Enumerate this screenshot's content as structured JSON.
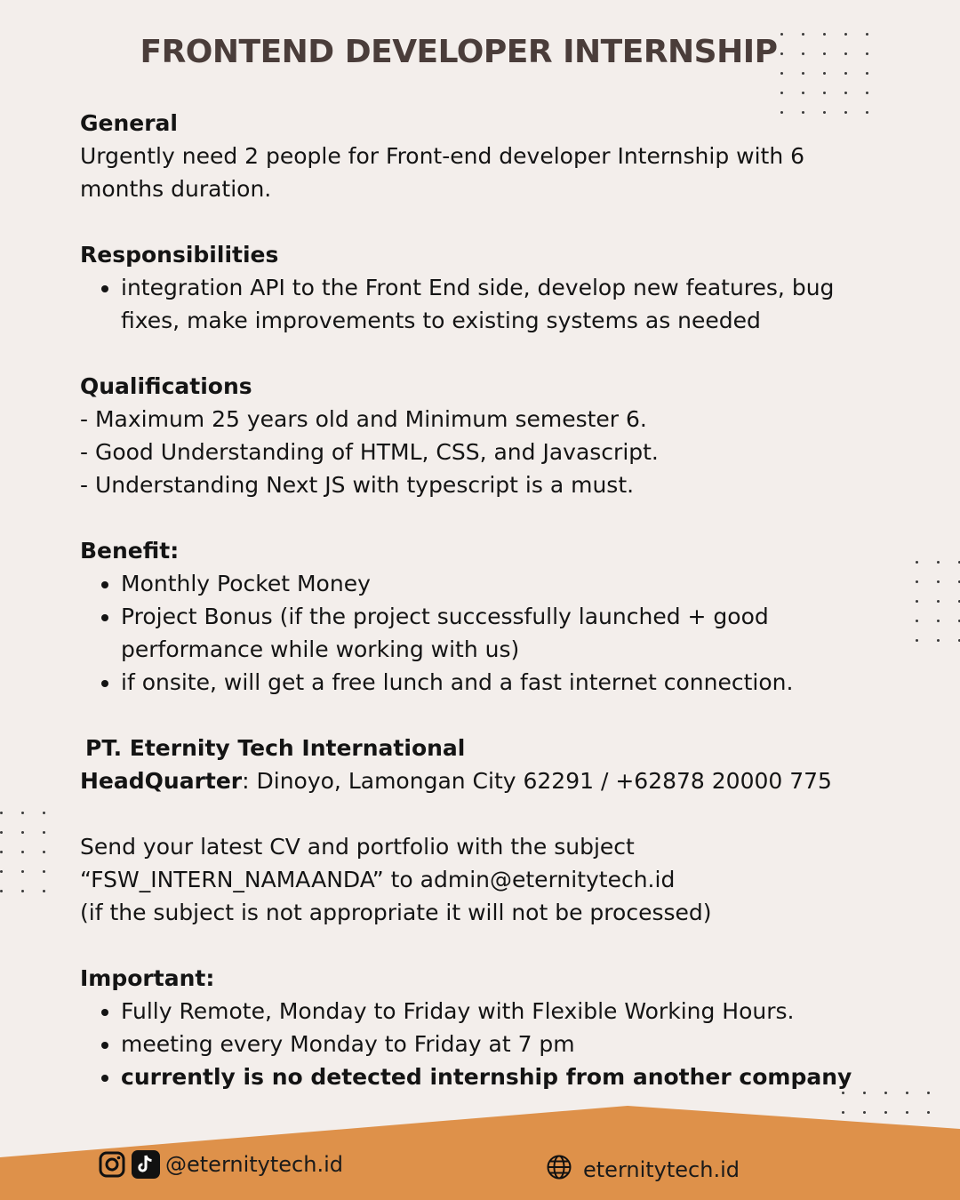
{
  "title": "FRONTEND DEVELOPER INTERNSHIP",
  "general": {
    "heading": "General",
    "text": "Urgently need 2 people for Front-end developer Internship with 6 months duration."
  },
  "responsibilities": {
    "heading": "Responsibilities",
    "items": [
      "integration API to the Front End side, develop new features, bug fixes, make improvements to existing systems as needed"
    ]
  },
  "qualifications": {
    "heading": "Qualifications",
    "lines": [
      "- Maximum 25 years old and Minimum semester 6.",
      "- Good Understanding of HTML, CSS, and Javascript.",
      "- Understanding Next JS with typescript is a must."
    ]
  },
  "benefit": {
    "heading": "Benefit:",
    "items": [
      "Monthly Pocket Money",
      "Project Bonus (if the project successfully launched + good performance while working with us)",
      "if onsite, will get a free lunch and a fast internet connection."
    ]
  },
  "company": {
    "name": "PT. Eternity Tech International",
    "hq_label": "HeadQuarter",
    "hq_text": ": Dinoyo, Lamongan City 62291 / +62878 20000 775"
  },
  "apply": {
    "line1": "Send your latest CV and portfolio with the subject",
    "line2": "“FSW_INTERN_NAMAANDA” to admin@eternitytech.id",
    "line3": "(if the subject is not appropriate it will not be processed)"
  },
  "important": {
    "heading": "Important:",
    "items": [
      "Fully Remote, Monday to Friday with Flexible Working Hours.",
      "meeting every Monday to Friday at 7 pm"
    ],
    "bold_item": "currently is no detected internship from another company"
  },
  "footer": {
    "social_handle": "@eternitytech.id",
    "website": "eternitytech.id",
    "band_color": "#de914a"
  },
  "icons": [
    "instagram-icon",
    "tiktok-icon",
    "globe-icon"
  ]
}
